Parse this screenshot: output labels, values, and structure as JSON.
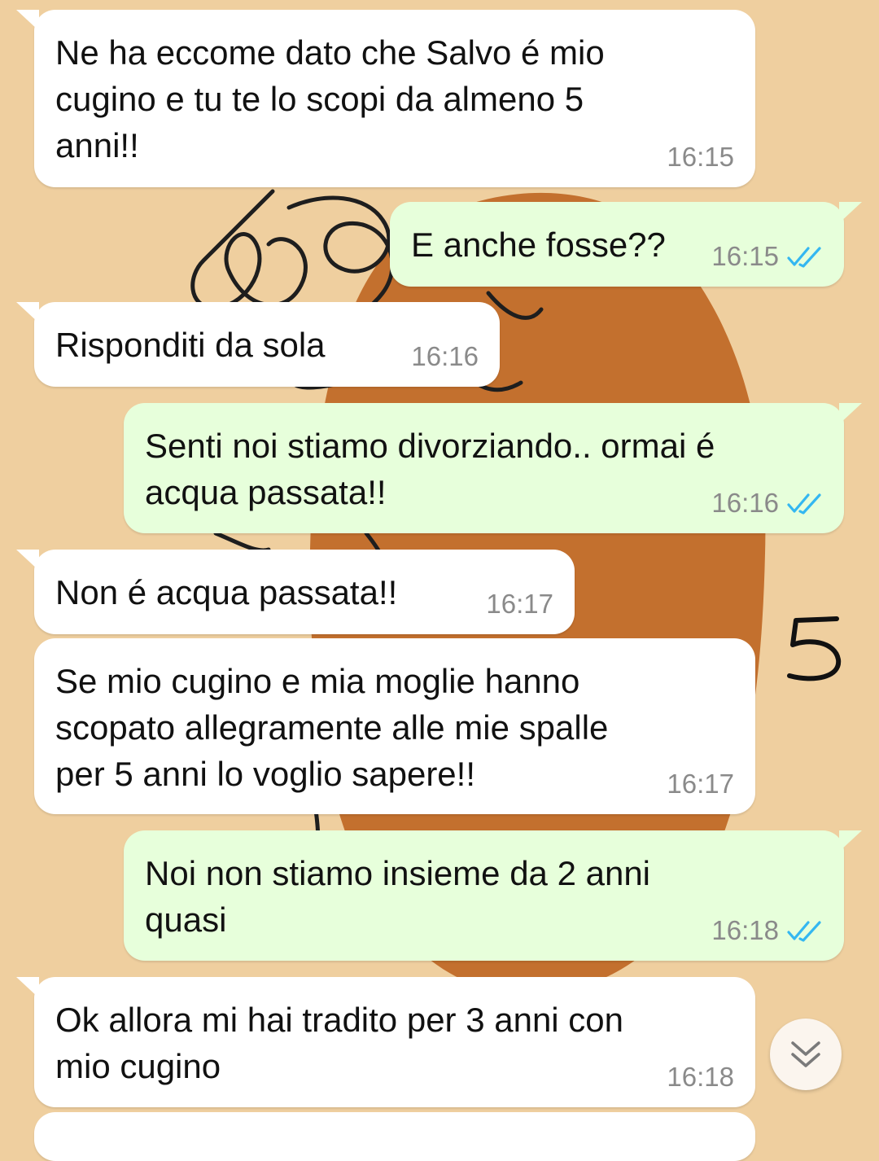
{
  "chat": {
    "messages": [
      {
        "direction": "in",
        "text": "Ne ha eccome dato che Salvo é mio\ncugino e tu te lo scopi da almeno 5\nanni!!",
        "time": "16:15"
      },
      {
        "direction": "out",
        "text": "E anche fosse??",
        "time": "16:15",
        "status": "read"
      },
      {
        "direction": "in",
        "text": "Risponditi da sola",
        "time": "16:16"
      },
      {
        "direction": "out",
        "text": "Senti noi stiamo divorziando.. ormai é\nacqua passata!!",
        "time": "16:16",
        "status": "read"
      },
      {
        "direction": "in",
        "text": "Non é acqua passata!!",
        "time": "16:17"
      },
      {
        "direction": "in",
        "text": "Se mio cugino e mia moglie hanno\nscopato allegramente alle mie spalle\nper 5 anni lo voglio sapere!!",
        "time": "16:17"
      },
      {
        "direction": "out",
        "text": "Noi non stiamo insieme da 2 anni\nquasi",
        "time": "16:18",
        "status": "read"
      },
      {
        "direction": "in",
        "text": "Ok allora mi hai tradito per 3 anni con\nmio cugino",
        "time": "16:18"
      }
    ]
  },
  "annotation": {
    "text": "5"
  },
  "scroll_button": {
    "icon": "double-chevron-down-icon"
  },
  "colors": {
    "incoming_bubble": "#FFFFFF",
    "outgoing_bubble": "#E7FFDB",
    "read_ticks": "#34B7F1",
    "wallpaper": "#EFCF9F",
    "wallpaper_shape": "#C3702E"
  }
}
